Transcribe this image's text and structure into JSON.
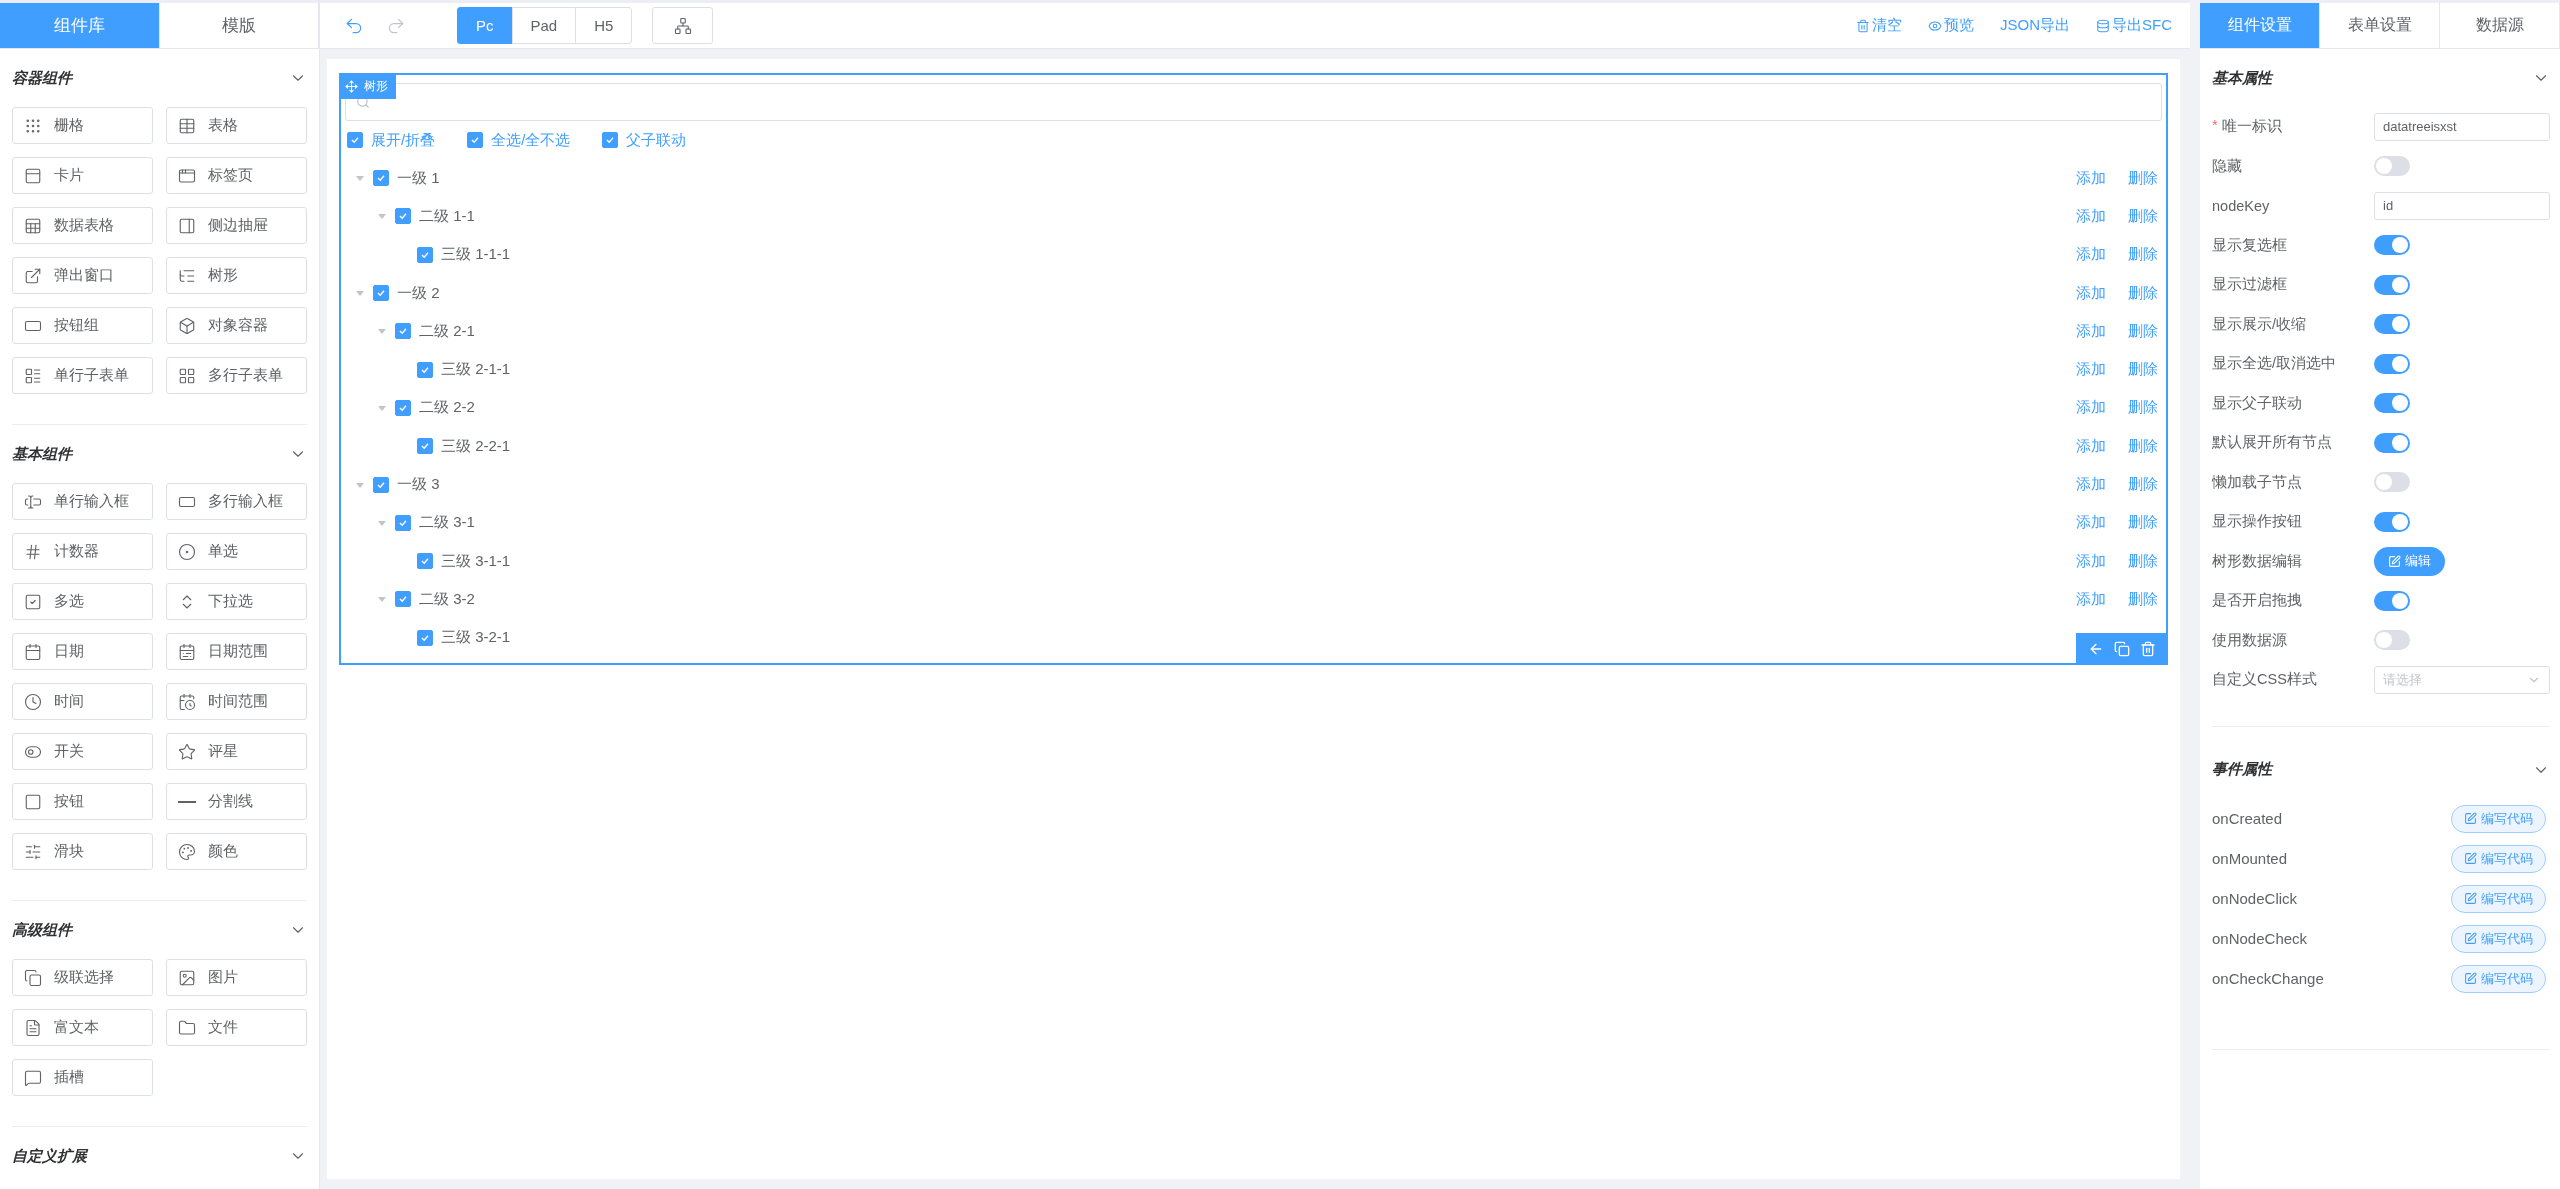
{
  "left_panel": {
    "tabs": [
      {
        "label": "组件库",
        "selected": true
      },
      {
        "label": "模版",
        "selected": false
      }
    ],
    "sections": [
      {
        "title": "容器组件",
        "items": [
          "栅格",
          "表格",
          "卡片",
          "标签页",
          "数据表格",
          "侧边抽屉",
          "弹出窗口",
          "树形",
          "按钮组",
          "对象容器",
          "单行子表单",
          "多行子表单"
        ]
      },
      {
        "title": "基本组件",
        "items": [
          "单行输入框",
          "多行输入框",
          "计数器",
          "单选",
          "多选",
          "下拉选",
          "日期",
          "日期范围",
          "时间",
          "时间范围",
          "开关",
          "评星",
          "按钮",
          "分割线",
          "滑块",
          "颜色"
        ]
      },
      {
        "title": "高级组件",
        "items": [
          "级联选择",
          "图片",
          "富文本",
          "文件",
          "插槽"
        ]
      },
      {
        "title": "自定义扩展"
      }
    ]
  },
  "toolbar": {
    "devices": [
      {
        "label": "Pc",
        "selected": true
      },
      {
        "label": "Pad",
        "selected": false
      },
      {
        "label": "H5",
        "selected": false
      }
    ],
    "actions": [
      "清空",
      "预览",
      "JSON导出",
      "导出SFC"
    ]
  },
  "widget": {
    "tag": "树形",
    "options": [
      {
        "label": "展开/折叠",
        "checked": true
      },
      {
        "label": "全选/全不选",
        "checked": true
      },
      {
        "label": "父子联动",
        "checked": true
      }
    ],
    "tree": [
      {
        "label": "一级 1",
        "checked": true,
        "expanded": true,
        "actions": [
          "添加",
          "删除"
        ],
        "children": [
          {
            "label": "二级 1-1",
            "checked": true,
            "expanded": true,
            "actions": [
              "添加",
              "删除"
            ],
            "children": [
              {
                "label": "三级 1-1-1",
                "checked": true,
                "actions": [
                  "添加",
                  "删除"
                ]
              }
            ]
          }
        ]
      },
      {
        "label": "一级 2",
        "checked": true,
        "expanded": true,
        "actions": [
          "添加",
          "删除"
        ],
        "children": [
          {
            "label": "二级 2-1",
            "checked": true,
            "expanded": true,
            "actions": [
              "添加",
              "删除"
            ],
            "children": [
              {
                "label": "三级 2-1-1",
                "checked": true,
                "actions": [
                  "添加",
                  "删除"
                ]
              }
            ]
          },
          {
            "label": "二级 2-2",
            "checked": true,
            "expanded": true,
            "actions": [
              "添加",
              "删除"
            ],
            "children": [
              {
                "label": "三级 2-2-1",
                "checked": true,
                "actions": [
                  "添加",
                  "删除"
                ]
              }
            ]
          }
        ]
      },
      {
        "label": "一级 3",
        "checked": true,
        "expanded": true,
        "actions": [
          "添加",
          "删除"
        ],
        "children": [
          {
            "label": "二级 3-1",
            "checked": true,
            "expanded": true,
            "actions": [
              "添加",
              "删除"
            ],
            "children": [
              {
                "label": "三级 3-1-1",
                "checked": true,
                "actions": [
                  "添加",
                  "删除"
                ]
              }
            ]
          },
          {
            "label": "二级 3-2",
            "checked": true,
            "expanded": true,
            "actions": [
              "添加",
              "删除"
            ],
            "children": [
              {
                "label": "三级 3-2-1",
                "checked": true
              }
            ]
          }
        ]
      }
    ]
  },
  "right_panel": {
    "tabs": [
      {
        "label": "组件设置",
        "selected": true
      },
      {
        "label": "表单设置",
        "selected": false
      },
      {
        "label": "数据源",
        "selected": false
      }
    ],
    "basic": {
      "title": "基本属性",
      "props": [
        {
          "kind": "input",
          "label": "唯一标识",
          "required_mark": "*",
          "value": "datatreeisxst"
        },
        {
          "kind": "switch",
          "label": "隐藏",
          "on": false
        },
        {
          "kind": "input",
          "label": "nodeKey",
          "value": "id"
        },
        {
          "kind": "switch",
          "label": "显示复选框",
          "on": true
        },
        {
          "kind": "switch",
          "label": "显示过滤框",
          "on": true
        },
        {
          "kind": "switch",
          "label": "显示展示/收缩",
          "on": true
        },
        {
          "kind": "switch",
          "label": "显示全选/取消选中",
          "on": true
        },
        {
          "kind": "switch",
          "label": "显示父子联动",
          "on": true
        },
        {
          "kind": "switch",
          "label": "默认展开所有节点",
          "on": true
        },
        {
          "kind": "switch",
          "label": "懒加载子节点",
          "on": false
        },
        {
          "kind": "switch",
          "label": "显示操作按钮",
          "on": true
        },
        {
          "kind": "button",
          "label": "树形数据编辑",
          "button": "编辑"
        },
        {
          "kind": "switch",
          "label": "是否开启拖拽",
          "on": true
        },
        {
          "kind": "switch",
          "label": "使用数据源",
          "on": false
        },
        {
          "kind": "select",
          "label": "自定义CSS样式",
          "placeholder": "请选择"
        }
      ]
    },
    "events": {
      "title": "事件属性",
      "items": [
        {
          "name": "onCreated",
          "button": "编写代码"
        },
        {
          "name": "onMounted",
          "button": "编写代码"
        },
        {
          "name": "onNodeClick",
          "button": "编写代码"
        },
        {
          "name": "onNodeCheck",
          "button": "编写代码"
        },
        {
          "name": "onCheckChange",
          "button": "编写代码"
        }
      ]
    }
  }
}
